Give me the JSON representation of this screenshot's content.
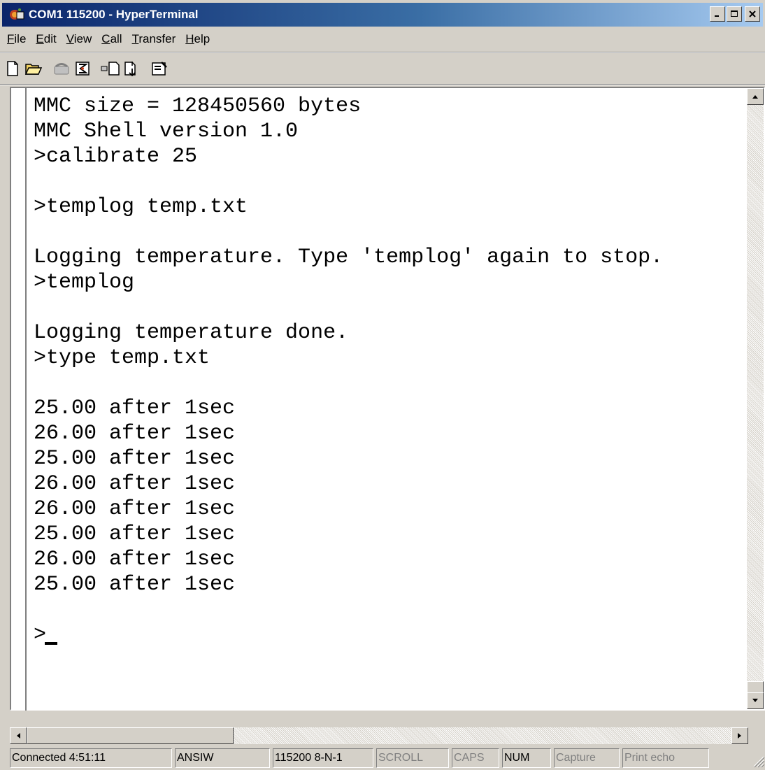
{
  "window": {
    "title": "COM1 115200 - HyperTerminal",
    "minimize_glyph": "_",
    "maximize_glyph": "□",
    "close_glyph": "×"
  },
  "menu": [
    {
      "accel": "F",
      "rest": "ile"
    },
    {
      "accel": "E",
      "rest": "dit"
    },
    {
      "accel": "V",
      "rest": "iew"
    },
    {
      "accel": "C",
      "rest": "all"
    },
    {
      "accel": "T",
      "rest": "ransfer"
    },
    {
      "accel": "H",
      "rest": "elp"
    }
  ],
  "toolbar": [
    {
      "icon": "new-document-icon"
    },
    {
      "icon": "open-folder-icon"
    },
    {
      "icon": "connect-phone-icon"
    },
    {
      "icon": "disconnect-icon"
    },
    {
      "icon": "send-file-icon"
    },
    {
      "icon": "receive-file-icon"
    },
    {
      "icon": "properties-icon"
    }
  ],
  "terminal": {
    "lines": [
      "MMC size = 128450560 bytes",
      "MMC Shell version 1.0",
      ">calibrate 25",
      "",
      ">templog temp.txt",
      "",
      "Logging temperature. Type 'templog' again to stop.",
      ">templog",
      "",
      "Logging temperature done.",
      ">type temp.txt",
      "",
      "25.00 after 1sec",
      "26.00 after 1sec",
      "25.00 after 1sec",
      "26.00 after 1sec",
      "26.00 after 1sec",
      "25.00 after 1sec",
      "26.00 after 1sec",
      "25.00 after 1sec",
      "",
      ">"
    ]
  },
  "status": {
    "connected": "Connected 4:51:11",
    "emulation": "ANSIW",
    "settings": "115200 8-N-1",
    "scroll": "SCROLL",
    "caps": "CAPS",
    "num": "NUM",
    "capture": "Capture",
    "print_echo": "Print echo"
  }
}
